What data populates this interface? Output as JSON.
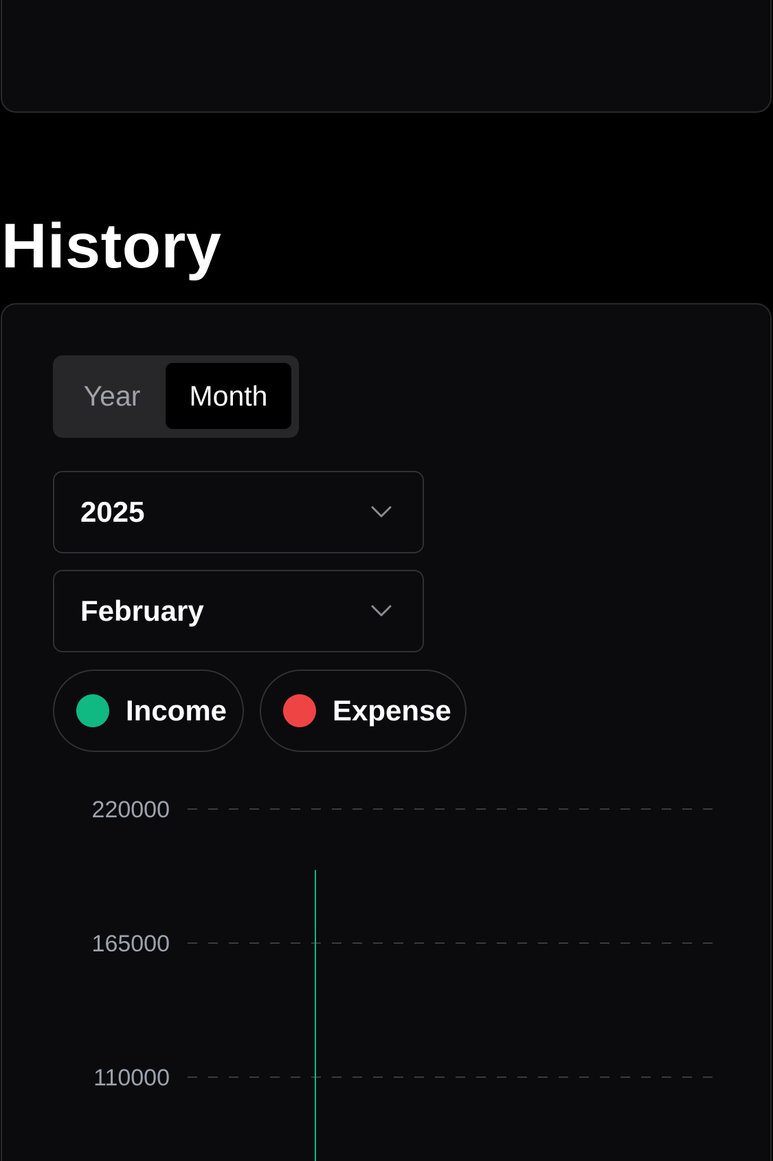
{
  "section": {
    "title": "History"
  },
  "toggle": {
    "options": [
      "Year",
      "Month"
    ],
    "selected": "Month"
  },
  "year_select": {
    "value": "2025"
  },
  "month_select": {
    "value": "February"
  },
  "legend": {
    "income": {
      "label": "Income",
      "color": "#10b981"
    },
    "expense": {
      "label": "Expense",
      "color": "#ef4444"
    }
  },
  "chart_data": {
    "type": "bar",
    "y_ticks": [
      "220000",
      "165000",
      "110000"
    ],
    "ylim": [
      0,
      220000
    ],
    "grid": true,
    "series": [
      {
        "name": "Income",
        "color": "#10b981",
        "values": [
          195000
        ]
      }
    ]
  }
}
